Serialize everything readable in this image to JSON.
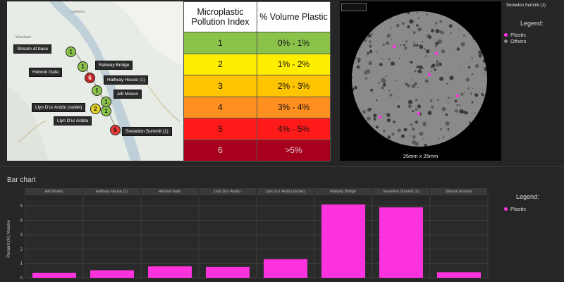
{
  "map": {
    "sites": [
      {
        "label": "Stream at base",
        "marker": "1",
        "color": "#8bc34a"
      },
      {
        "label": "Railway Bridge",
        "marker": "1",
        "color": "#8bc34a"
      },
      {
        "label": "Hebron Gate",
        "marker": "6",
        "color": "#c62828"
      },
      {
        "label": "Halfway House (1)",
        "marker": "1",
        "color": "#8bc34a"
      },
      {
        "label": "Allt Moses",
        "marker": "1",
        "color": "#8bc34a"
      },
      {
        "label": "Llyn D'ur Arddu (outlet)",
        "marker": "2",
        "color": "#e6d22a"
      },
      {
        "label": "Llyn D'ur Arddu",
        "marker": "1",
        "color": "#8bc34a"
      },
      {
        "label": "Snowdon Summit (1)",
        "marker": "5",
        "color": "#e53935"
      }
    ]
  },
  "index_table": {
    "headers": [
      "Microplastic Pollution Index",
      "% Volume Plastic"
    ],
    "rows": [
      {
        "index": "1",
        "range": "0% - 1%",
        "color": "#8bc34a"
      },
      {
        "index": "2",
        "range": "1% - 2%",
        "color": "#ffee00"
      },
      {
        "index": "3",
        "range": "2% - 3%",
        "color": "#ffc400"
      },
      {
        "index": "4",
        "range": "3% - 4%",
        "color": "#ff8f1f"
      },
      {
        "index": "5",
        "range": "4% - 5%",
        "color": "#ff1a1a"
      },
      {
        "index": "6",
        "range": ">5%",
        "color": "#a8001c"
      }
    ]
  },
  "micrograph": {
    "caption": "25mm x 25mm",
    "sample_title": "Snowdon Summit (1)",
    "legend_title": "Legend:",
    "legend": [
      {
        "label": "Plastic",
        "color": "#ff33dd"
      },
      {
        "label": "Others",
        "color": "#888888"
      }
    ]
  },
  "bar_section": {
    "title": "Bar chart",
    "legend_title": "Legend:",
    "legend": [
      {
        "label": "Plastic",
        "color": "#ff33dd"
      }
    ]
  },
  "chart_data": {
    "type": "bar",
    "categories": [
      "Allt Moses",
      "Halfway House (1)",
      "Hebron Gate",
      "Llyn Du'r Arddu",
      "Llyn Du'r Arddu (outlet)",
      "Railway Bridge",
      "Snowdon Summit (1)",
      "Stream at base"
    ],
    "series": [
      {
        "name": "Plastic",
        "values": [
          0.35,
          0.52,
          0.8,
          0.75,
          1.3,
          5.1,
          4.9,
          0.38
        ],
        "color": "#ff33dd"
      }
    ],
    "ylabel": "Percent (%) Volume",
    "yticks": [
      0,
      1,
      2,
      3,
      4,
      5
    ],
    "ylim": [
      0,
      5.4
    ],
    "grid": true
  }
}
